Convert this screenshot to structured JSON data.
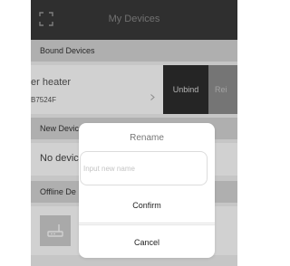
{
  "navbar": {
    "title": "My Devices",
    "scan_icon": "scan-frame-icon"
  },
  "sections": {
    "bound_devices": "Bound Devices",
    "new_devices": "New Devic",
    "offline_devices": "Offline De"
  },
  "bound_device": {
    "name": "er heater",
    "id": "B7524F",
    "unbind_label": "Unbind",
    "rename_label": "Rei"
  },
  "new_devices_empty": "No devic",
  "offline_device": {
    "icon": "router-icon"
  },
  "dialog": {
    "title": "Rename",
    "input_placeholder": "Input new name",
    "input_value": "",
    "confirm_label": "Confirm",
    "cancel_label": "Cancel"
  },
  "colors": {
    "navbar": "#3a3a3a",
    "section_header": "#d6d6d6",
    "unbind": "#2e2e2e",
    "rename": "#8f8f8f"
  }
}
